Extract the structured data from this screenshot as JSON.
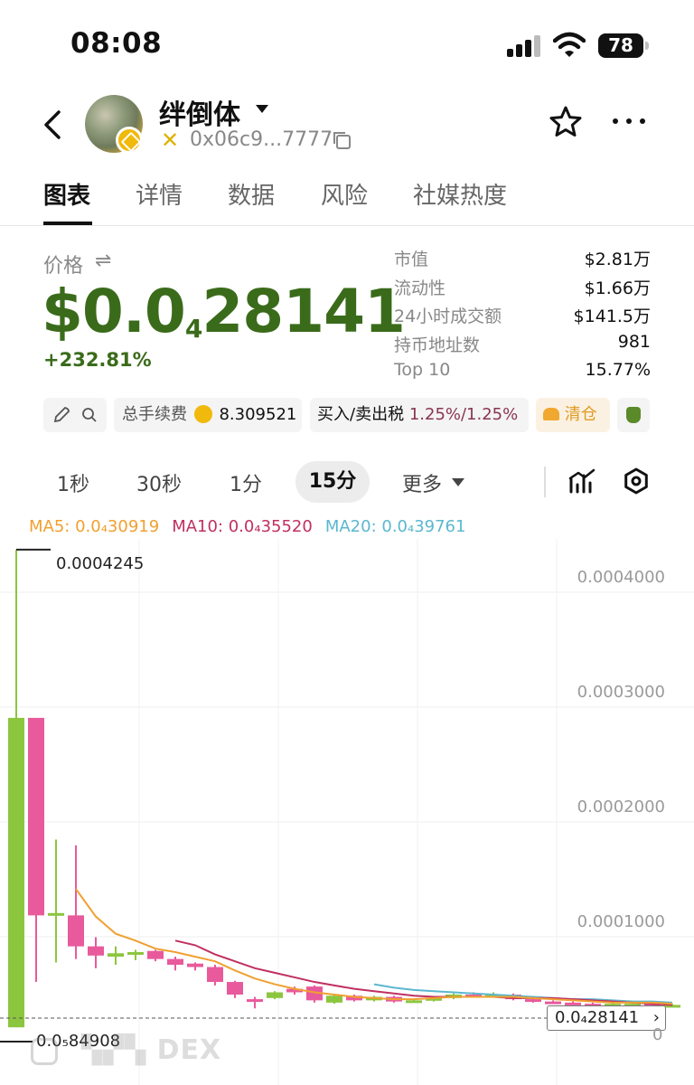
{
  "status_bar": {
    "time": "08:08",
    "battery": "78"
  },
  "header": {
    "token_name": "绊倒体",
    "address": "0x06c9...7777"
  },
  "tabs": [
    {
      "label": "图表",
      "active": true
    },
    {
      "label": "详情"
    },
    {
      "label": "数据"
    },
    {
      "label": "风险"
    },
    {
      "label": "社媒热度"
    }
  ],
  "price": {
    "label": "价格",
    "value_prefix": "$0.0",
    "value_subscript": "4",
    "value_suffix": "28141",
    "change": "+232.81%"
  },
  "stats": [
    {
      "label": "市值",
      "value": "$2.81万"
    },
    {
      "label": "流动性",
      "value": "$1.66万"
    },
    {
      "label": "24小时成交额",
      "value": "$141.5万"
    },
    {
      "label": "持币地址数",
      "value": "981"
    },
    {
      "label": "Top 10",
      "value": "15.77%"
    }
  ],
  "chips": {
    "fee_label": "总手续费",
    "fee_value": "8.309521",
    "tax_label": "买入/卖出税",
    "tax_value": "1.25%/1.25%",
    "clear_label": "清仓"
  },
  "intervals": [
    "1秒",
    "30秒",
    "1分",
    "15分",
    "更多"
  ],
  "active_interval": "15分",
  "ma_legend": {
    "ma5": "MA5: 0.0₄30919",
    "ma10": "MA10: 0.0₄35520",
    "ma20": "MA20: 0.0₄39761"
  },
  "colors": {
    "up": "#8cc63f",
    "down": "#e85a9b",
    "price_green": "#3a6b1a",
    "ma5": "#f0a030",
    "ma10": "#c03060",
    "ma20": "#5ab8d0"
  },
  "chart_data": {
    "type": "candlestick",
    "y_ticks": [
      "0.0004000",
      "0.0003000",
      "0.0002000",
      "0.0001000"
    ],
    "ylim": [
      0,
      0.00045
    ],
    "high_label": "0.0004245",
    "low_label": "0.0₅84908",
    "current_label": "0.0₄28141",
    "zero_label": "0",
    "candles": [
      {
        "o": 8.5e-06,
        "c": 0.000278,
        "h": 0.0004245,
        "l": 8.5e-06
      },
      {
        "o": 0.000278,
        "c": 0.000106,
        "h": 0.000278,
        "l": 4.8e-05
      },
      {
        "o": 0.000106,
        "c": 0.000108,
        "h": 0.000172,
        "l": 6.5e-05
      },
      {
        "o": 0.000106,
        "c": 7.9e-05,
        "h": 0.000167,
        "l": 6.8e-05
      },
      {
        "o": 7.9e-05,
        "c": 7.1e-05,
        "h": 8.7e-05,
        "l": 6e-05
      },
      {
        "o": 7e-05,
        "c": 7.3e-05,
        "h": 7.9e-05,
        "l": 6.3e-05
      },
      {
        "o": 7.2e-05,
        "c": 7.4e-05,
        "h": 7.6e-05,
        "l": 6.7e-05
      },
      {
        "o": 7.5e-05,
        "c": 6.8e-05,
        "h": 7.6e-05,
        "l": 6.6e-05
      },
      {
        "o": 6.8e-05,
        "c": 6.3e-05,
        "h": 7e-05,
        "l": 5.8e-05
      },
      {
        "o": 6.4e-05,
        "c": 6.1e-05,
        "h": 6.5e-05,
        "l": 5.8e-05
      },
      {
        "o": 6.1e-05,
        "c": 4.8e-05,
        "h": 6.3e-05,
        "l": 4.5e-05
      },
      {
        "o": 4.8e-05,
        "c": 3.7e-05,
        "h": 4.9e-05,
        "l": 3.4e-05
      },
      {
        "o": 3.3e-05,
        "c": 3.2e-05,
        "h": 3.5e-05,
        "l": 2.5e-05
      },
      {
        "o": 3.4e-05,
        "c": 3.9e-05,
        "h": 4e-05,
        "l": 3.3e-05
      },
      {
        "o": 4.2e-05,
        "c": 3.9e-05,
        "h": 4.4e-05,
        "l": 3.7e-05
      },
      {
        "o": 4.4e-05,
        "c": 3.2e-05,
        "h": 4.5e-05,
        "l": 3e-05
      },
      {
        "o": 3e-05,
        "c": 3.6e-05,
        "h": 3.7e-05,
        "l": 2.9e-05
      },
      {
        "o": 3.6e-05,
        "c": 3.2e-05,
        "h": 3.7e-05,
        "l": 3.1e-05
      },
      {
        "o": 3.2e-05,
        "c": 3.5e-05,
        "h": 3.6e-05,
        "l": 3.1e-05
      },
      {
        "o": 3.5e-05,
        "c": 3.1e-05,
        "h": 3.6e-05,
        "l": 3e-05
      },
      {
        "o": 3.1e-05,
        "c": 3.2e-05,
        "h": 3.3e-05,
        "l": 3e-05
      },
      {
        "o": 3.2e-05,
        "c": 3.4e-05,
        "h": 3.5e-05,
        "l": 3.1e-05
      },
      {
        "o": 3.4e-05,
        "c": 3.7e-05,
        "h": 3.8e-05,
        "l": 3.3e-05
      },
      {
        "o": 3.7e-05,
        "c": 3.6e-05,
        "h": 3.9e-05,
        "l": 3.5e-05
      },
      {
        "o": 3.6e-05,
        "c": 3.7e-05,
        "h": 3.9e-05,
        "l": 3.5e-05
      },
      {
        "o": 3.7e-05,
        "c": 3.3e-05,
        "h": 3.8e-05,
        "l": 3.2e-05
      },
      {
        "o": 3.3e-05,
        "c": 3.1e-05,
        "h": 3.4e-05,
        "l": 3e-05
      },
      {
        "o": 3.1e-05,
        "c": 3e-05,
        "h": 3.2e-05,
        "l": 2.9e-05
      },
      {
        "o": 3e-05,
        "c": 2.9e-05,
        "h": 3.1e-05,
        "l": 2.8e-05
      },
      {
        "o": 2.9e-05,
        "c": 2.8e-05,
        "h": 3e-05,
        "l": 2.7e-05
      },
      {
        "o": 2.8e-05,
        "c": 2.9e-05,
        "h": 3e-05,
        "l": 2.7e-05
      },
      {
        "o": 2.9e-05,
        "c": 2.9e-05,
        "h": 3e-05,
        "l": 2.8e-05
      },
      {
        "o": 2.9e-05,
        "c": 2.8e-05,
        "h": 3e-05,
        "l": 2.7e-05
      },
      {
        "o": 2.8e-05,
        "c": 2.8e-05,
        "h": 2.9e-05,
        "l": 2.7e-05
      }
    ],
    "ma5": [
      null,
      null,
      null,
      0.000129,
      0.000105,
      9e-05,
      8.4e-05,
      7.7e-05,
      7.4e-05,
      7e-05,
      6.6e-05,
      5.8e-05,
      5.1e-05,
      4.6e-05,
      4.2e-05,
      3.9e-05,
      3.7e-05,
      3.5e-05,
      3.4e-05,
      3.3e-05,
      3.3e-05,
      3.4e-05,
      3.5e-05,
      3.5e-05,
      3.5e-05,
      3.5e-05,
      3.4e-05,
      3.3e-05,
      3.2e-05,
      3.1e-05,
      3e-05,
      3e-05,
      3e-05,
      2.9e-05
    ],
    "ma10": [
      null,
      null,
      null,
      null,
      null,
      null,
      null,
      null,
      8.4e-05,
      8e-05,
      7.2e-05,
      6.6e-05,
      6e-05,
      5.6e-05,
      5.2e-05,
      4.8e-05,
      4.5e-05,
      4.2e-05,
      4e-05,
      3.8e-05,
      3.6e-05,
      3.5e-05,
      3.5e-05,
      3.5e-05,
      3.5e-05,
      3.4e-05,
      3.4e-05,
      3.4e-05,
      3.3e-05,
      3.2e-05,
      3.1e-05,
      3e-05,
      2.9e-05,
      2.8e-05
    ],
    "ma20": [
      null,
      null,
      null,
      null,
      null,
      null,
      null,
      null,
      null,
      null,
      null,
      null,
      null,
      null,
      null,
      null,
      null,
      null,
      4.6e-05,
      4.3e-05,
      4.1e-05,
      4e-05,
      3.9e-05,
      3.8e-05,
      3.7e-05,
      3.6e-05,
      3.5e-05,
      3.4e-05,
      3.3e-05,
      3.3e-05,
      3.2e-05,
      3.1e-05,
      3.1e-05,
      3e-05
    ]
  }
}
